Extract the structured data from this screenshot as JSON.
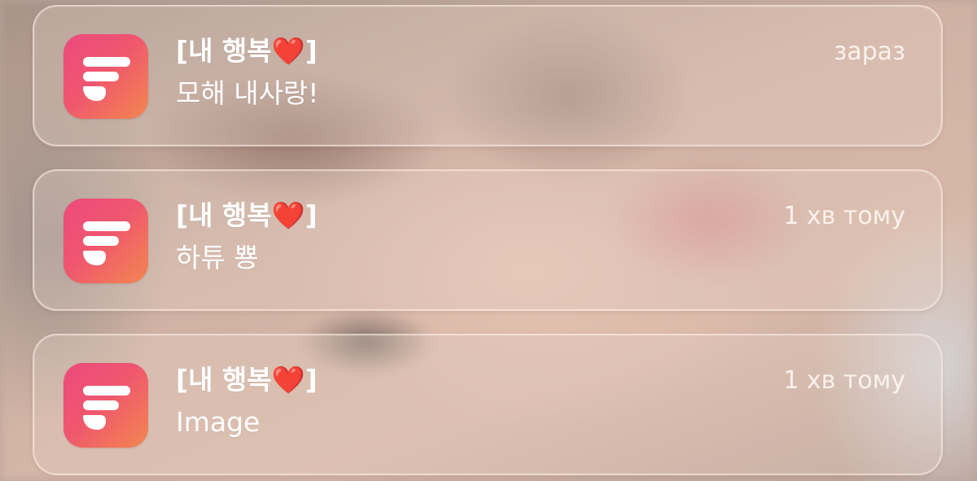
{
  "notifications": [
    {
      "app_icon": "app-logo-icon",
      "title": "[내 행복❤️]",
      "message": "모해 내사랑!",
      "time": "зараз"
    },
    {
      "app_icon": "app-logo-icon",
      "title": "[내 행복❤️]",
      "message": "하튜 뿅",
      "time": "1 хв тому"
    },
    {
      "app_icon": "app-logo-icon",
      "title": "[내 행복❤️]",
      "message": "Image",
      "time": "1 хв тому"
    }
  ],
  "colors": {
    "icon_gradient_start": "#ec4a7d",
    "icon_gradient_end": "#f3874f",
    "text": "#ffffff"
  }
}
